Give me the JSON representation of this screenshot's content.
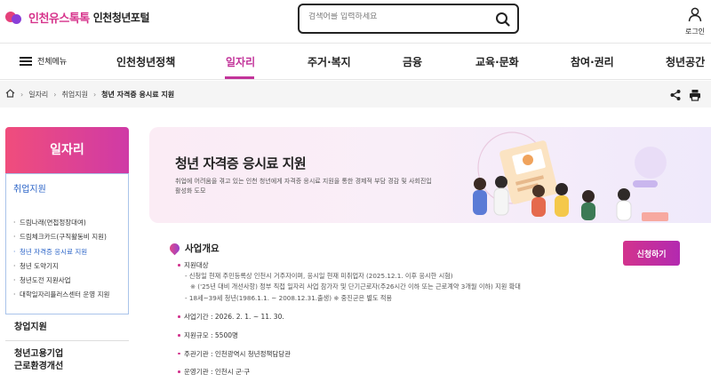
{
  "header": {
    "logo_text": "인천유스톡톡",
    "portal_name": "인천청년포털",
    "search_placeholder": "검색어를 입력하세요",
    "login_label": "로그인"
  },
  "gnb": {
    "all_menu_label": "전체메뉴",
    "items": [
      "인천청년정책",
      "일자리",
      "주거·복지",
      "금융",
      "교육·문화",
      "참여·권리",
      "청년공간"
    ],
    "active_index": 1
  },
  "breadcrumb": [
    "일자리",
    "취업지원",
    "청년 자격증 응시료 지원"
  ],
  "sidebar": {
    "title": "일자리",
    "sub_title": "취업지원",
    "items": [
      "드림나래(면접정장대여)",
      "드림체크카드(구직활동비 지원)",
      "청년 자격증 응시료 지원",
      "청년 도약기지",
      "청년도전 지원사업",
      "대학일자리플러스센터 운영 지원"
    ],
    "active_index": 2,
    "main_items": [
      "창업지원",
      "청년고용기업 근로환경개선"
    ]
  },
  "banner": {
    "title": "청년 자격증 응시료 지원",
    "description": "취업에 어려움을 겪고 있는 인천 청년에게 자격증 응시료 지원을 통한 경제적 부담 경감 및 사회진입 활성화 도모"
  },
  "overview": {
    "title": "사업개요",
    "apply_label": "신청하기",
    "target_label": "지원대상",
    "target_lines": [
      "- 신청일 현재 주민등록상 인천시 거주자이며, 응시일 현재 미취업자 (2025.12.1. 이후 응시한 시험)",
      "※ ('25년 대비 개선사항) 정부 직접 일자리 사업 참가자 및 단기근로자(주26시간 이하 또는 근로계약 3개월 이하) 지원 확대",
      "- 18세~39세 청년(1986.1.1. ~ 2008.12.31.출생) ※ 중진군은 별도 적용"
    ],
    "period": "사업기간 : 2026. 2. 1. ~ 11. 30.",
    "scale": "지원규모 : 5500명",
    "host": "주관기관 : 인천광역시 청년정책담당관",
    "operator": "운영기관 : 인천시 군·구"
  }
}
